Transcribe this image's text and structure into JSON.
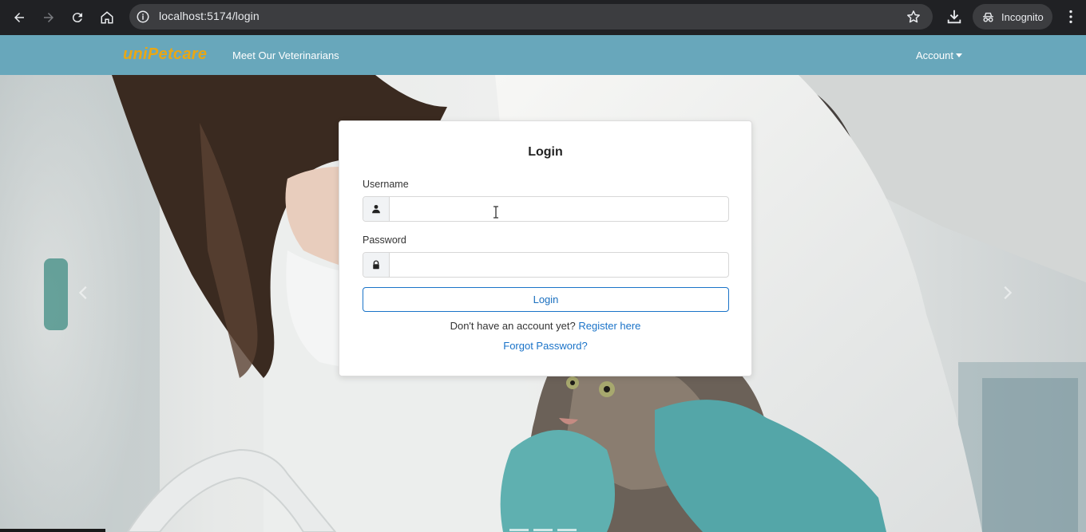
{
  "browser": {
    "url": "localhost:5174/login",
    "incognito_label": "Incognito",
    "icons": [
      "back-arrow-icon",
      "forward-arrow-icon",
      "reload-icon",
      "home-icon",
      "site-info-icon",
      "bookmark-star-icon",
      "download-icon",
      "incognito-icon",
      "kebab-menu-icon"
    ]
  },
  "navbar": {
    "brand": "uniPetcare",
    "links": [
      "Meet Our Veterinarians"
    ],
    "account_label": "Account",
    "background": "#68a7bb",
    "brand_color": "#e9a714"
  },
  "login": {
    "title": "Login",
    "username_label": "Username",
    "username_value": "",
    "username_icon": "user-icon",
    "password_label": "Password",
    "password_value": "",
    "password_icon": "lock-icon",
    "submit_label": "Login",
    "register_prompt": "Don't have an account yet?",
    "register_link": "Register here",
    "forgot_link": "Forgot Password?",
    "accent": "#1a73c8"
  },
  "hero": {
    "description_icons": [
      "carousel-prev-icon",
      "carousel-next-icon"
    ]
  }
}
